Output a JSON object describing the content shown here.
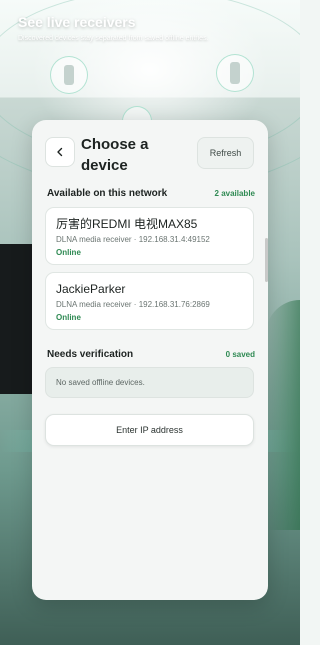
{
  "header": {
    "title": "See live receivers",
    "subtitle": "Discovered devices stay separated from saved offline entries."
  },
  "sheet": {
    "title": "Choose a device",
    "back_icon": "chevron-left-icon",
    "refresh_label": "Refresh"
  },
  "available": {
    "label": "Available on this network",
    "count": "2 available",
    "devices": [
      {
        "name": "厉害的REDMI 电视MAX85",
        "meta": "DLNA media receiver · 192.168.31.4:49152",
        "status": "Online"
      },
      {
        "name": "JackieParker",
        "meta": "DLNA media receiver · 192.168.31.76:2869",
        "status": "Online"
      }
    ]
  },
  "verification": {
    "label": "Needs verification",
    "count": "0 saved",
    "empty_text": "No saved offline devices."
  },
  "ip_button": {
    "label": "Enter IP address"
  },
  "colors": {
    "accent_green": "#2f8a53",
    "sheet_bg": "#f4f6f5",
    "text_primary": "#1d2321"
  }
}
